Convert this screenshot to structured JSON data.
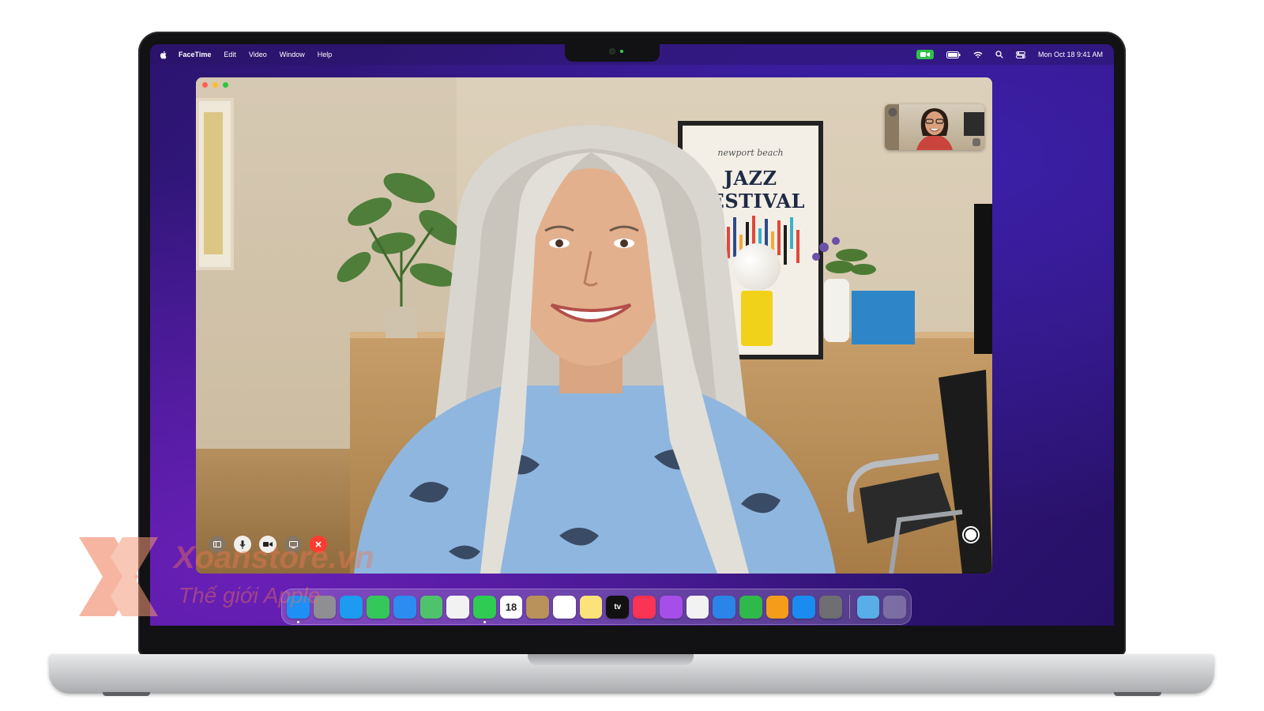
{
  "menubar": {
    "app_name": "FaceTime",
    "items": [
      "Edit",
      "Video",
      "Window",
      "Help"
    ],
    "datetime": "Mon Oct 18  9:41 AM"
  },
  "poster": {
    "script_text": "newport beach",
    "title": "JAZZ FESTIVAL"
  },
  "dock": {
    "calendar_day": "18",
    "tv_label": "tv",
    "apps": [
      {
        "name": "finder",
        "color": "#1e8ff5"
      },
      {
        "name": "launchpad",
        "color": "#8e8e93"
      },
      {
        "name": "safari",
        "color": "#1c9bf0"
      },
      {
        "name": "messages",
        "color": "#34c759"
      },
      {
        "name": "mail",
        "color": "#2d8cf0"
      },
      {
        "name": "maps",
        "color": "#4fc36b"
      },
      {
        "name": "photos",
        "color": "#f2f2f2"
      },
      {
        "name": "facetime",
        "color": "#2ecc52"
      },
      {
        "name": "calendar",
        "color": "#ffffff"
      },
      {
        "name": "contacts",
        "color": "#b8925a"
      },
      {
        "name": "reminders",
        "color": "#ffffff"
      },
      {
        "name": "notes",
        "color": "#fbe27a"
      },
      {
        "name": "apple-tv",
        "color": "#111111"
      },
      {
        "name": "music",
        "color": "#fa3455"
      },
      {
        "name": "podcasts",
        "color": "#a64ee8"
      },
      {
        "name": "news",
        "color": "#f2f2f2"
      },
      {
        "name": "keynote",
        "color": "#2b85e6"
      },
      {
        "name": "numbers",
        "color": "#2fb94a"
      },
      {
        "name": "pages",
        "color": "#f59c1b"
      },
      {
        "name": "app-store",
        "color": "#1a8cf0"
      },
      {
        "name": "system-preferences",
        "color": "#6e6e73"
      }
    ]
  },
  "watermark": {
    "name": "Xoanstore.vn",
    "tagline": "Thế giới Apple"
  },
  "colors": {
    "accent_green": "#2fc04a",
    "end_call_red": "#ff3b30",
    "wallpaper_purple": "#3a1a8c"
  }
}
